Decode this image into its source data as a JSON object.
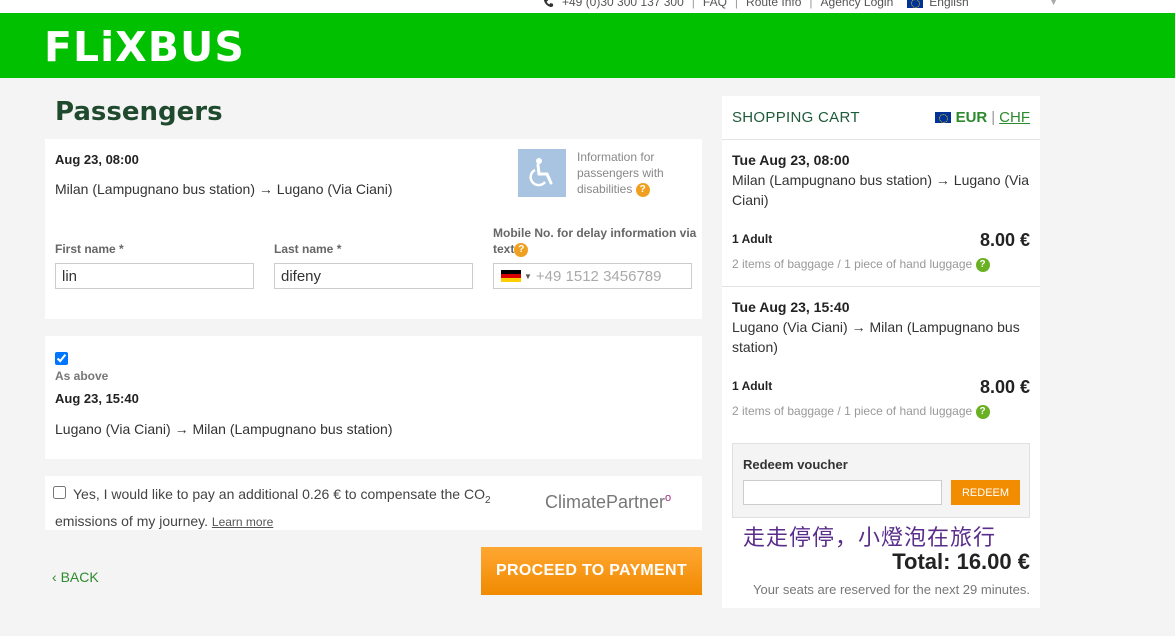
{
  "topbar": {
    "phone": "+49 (0)30 300 137 300",
    "faq": "FAQ",
    "route_info": "Route Info",
    "agency_login": "Agency Login",
    "language": "English"
  },
  "header": {
    "logo": "FLiXBUS",
    "brand_color": "#00c000"
  },
  "page_title": "Passengers",
  "trip1": {
    "date": "Aug 23, 08:00",
    "route": "Milan (Lampugnano bus station) → Lugano (Via Ciani)",
    "disability_info": "Information for passengers with disabilities"
  },
  "form": {
    "first_name_label": "First name *",
    "first_name_value": "lin",
    "last_name_label": "Last name *",
    "last_name_value": "difeny",
    "mobile_label": "Mobile No. for delay information via text",
    "mobile_placeholder": "+49 1512 3456789"
  },
  "trip2": {
    "as_above_label": "As above",
    "as_above_checked": true,
    "date": "Aug 23, 15:40",
    "route": "Lugano (Via Ciani) → Milan (Lampugnano bus station)"
  },
  "co2": {
    "text_before": "Yes, I would like to pay an additional 0.26 € to compensate the CO",
    "subscript": "2",
    "text_after": " emissions of my journey.",
    "learn_more": "Learn more",
    "partner_logo": "ClimatePartner",
    "partner_mark": "o",
    "checked": false
  },
  "actions": {
    "back": "BACK",
    "proceed": "PROCEED TO PAYMENT",
    "proceed_color": "#f08a00"
  },
  "cart": {
    "title": "SHOPPING CART",
    "currency_active": "EUR",
    "currency_other": "CHF",
    "items": [
      {
        "date": "Tue Aug 23, 08:00",
        "route": "Milan (Lampugnano bus station) → Lugano (Via Ciani)",
        "passengers": "1 Adult",
        "price": "8.00 €",
        "baggage": "2 items of baggage / 1 piece of hand luggage"
      },
      {
        "date": "Tue Aug 23, 15:40",
        "route": "Lugano (Via Ciani) → Milan (Lampugnano bus station)",
        "passengers": "1 Adult",
        "price": "8.00 €",
        "baggage": "2 items of baggage / 1 piece of hand luggage"
      }
    ],
    "voucher_title": "Redeem voucher",
    "voucher_value": "",
    "redeem": "REDEEM",
    "total": "Total: 16.00 €",
    "reserved": "Your seats are reserved for the next 29 minutes."
  },
  "watermark": "走走停停，小燈泡在旅行"
}
